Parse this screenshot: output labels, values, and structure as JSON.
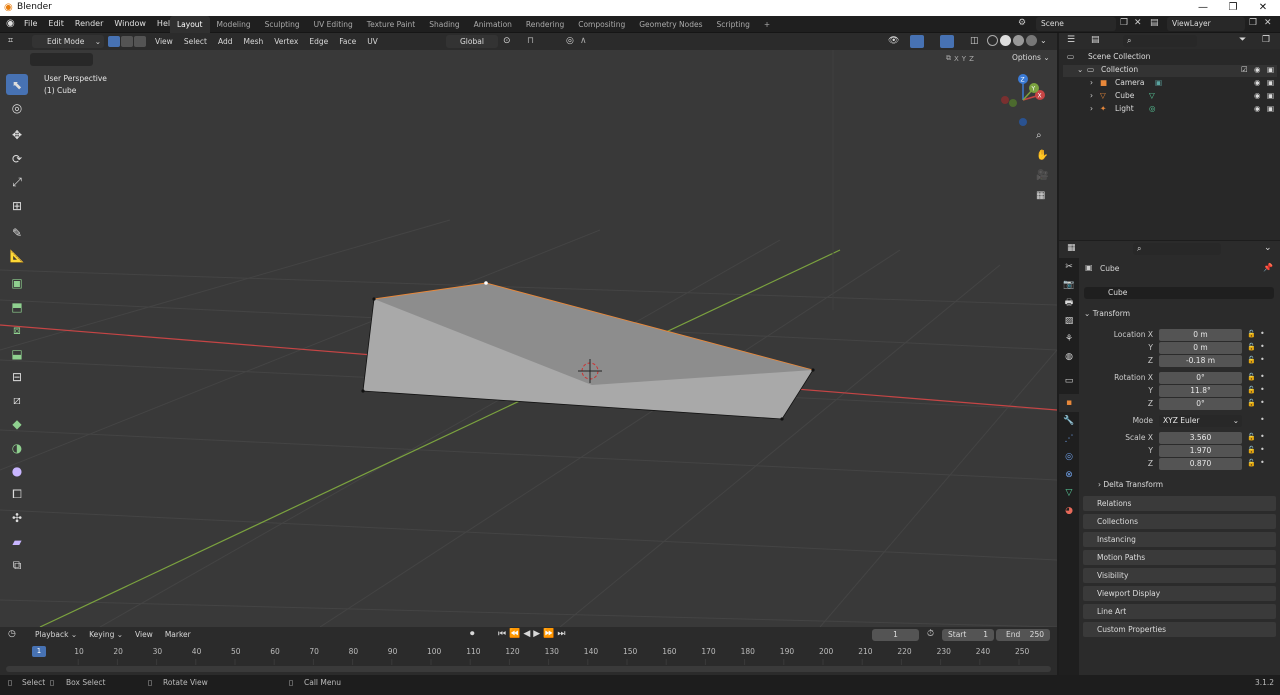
{
  "window": {
    "title": "Blender",
    "minimize": "—",
    "maximize": "❐",
    "close": "✕"
  },
  "menu": [
    "File",
    "Edit",
    "Render",
    "Window",
    "Help"
  ],
  "workspaces": [
    "Layout",
    "Modeling",
    "Sculpting",
    "UV Editing",
    "Texture Paint",
    "Shading",
    "Animation",
    "Rendering",
    "Compositing",
    "Geometry Nodes",
    "Scripting"
  ],
  "active_workspace": "Layout",
  "add_workspace": "+",
  "scene": {
    "label": "Scene",
    "view_layer": "ViewLayer"
  },
  "viewport_header": {
    "mode": "Edit Mode",
    "menus": [
      "View",
      "Select",
      "Add",
      "Mesh",
      "Vertex",
      "Edge",
      "Face",
      "UV"
    ],
    "transform_orientation": "Global",
    "options": "Options",
    "axes": [
      "X",
      "Y",
      "Z"
    ]
  },
  "viewport": {
    "perspective": "User Perspective",
    "object": "(1) Cube"
  },
  "outliner": {
    "root": "Scene Collection",
    "collection": "Collection",
    "items": [
      "Camera",
      "Cube",
      "Light"
    ]
  },
  "properties": {
    "object_name": "Cube",
    "data_name": "Cube",
    "transform_title": "Transform",
    "location_label": "Location X",
    "rotation_label": "Rotation X",
    "scale_label": "Scale X",
    "y": "Y",
    "z": "Z",
    "location": [
      "0 m",
      "0 m",
      "-0.18 m"
    ],
    "rotation": [
      "0°",
      "11.8°",
      "0°"
    ],
    "mode_label": "Mode",
    "mode": "XYZ Euler",
    "scale": [
      "3.560",
      "1.970",
      "0.870"
    ],
    "delta": "Delta Transform",
    "panels": [
      "Relations",
      "Collections",
      "Instancing",
      "Motion Paths",
      "Visibility",
      "Viewport Display",
      "Line Art",
      "Custom Properties"
    ]
  },
  "timeline": {
    "menus": [
      "Playback",
      "Keying",
      "View",
      "Marker"
    ],
    "current_frame": "1",
    "start_label": "Start",
    "start": "1",
    "end_label": "End",
    "end": "250",
    "ticks": [
      "10",
      "20",
      "30",
      "40",
      "50",
      "60",
      "70",
      "80",
      "90",
      "100",
      "110",
      "120",
      "130",
      "140",
      "150",
      "160",
      "170",
      "180",
      "190",
      "200",
      "210",
      "220",
      "230",
      "240",
      "250"
    ],
    "playhead": "1"
  },
  "status": {
    "select": "Select",
    "box_select": "Box Select",
    "rotate": "Rotate View",
    "call_menu": "Call Menu",
    "version": "3.1.2"
  },
  "colors": {
    "accent": "#4772b3",
    "x_axis": "#c64545",
    "y_axis": "#7ba23f",
    "z_axis": "#3b7bd6",
    "edge_select": "#e8883a"
  }
}
